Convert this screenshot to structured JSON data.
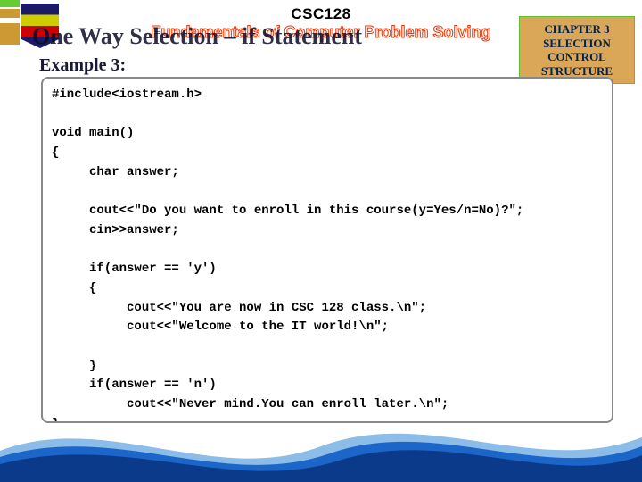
{
  "course_code": "CSC128",
  "course_subtitle": "Fundamentals of Computer Problem Solving",
  "title_overlay": "One Way Selection – if Statement",
  "example_label": "Example 3:",
  "chapter_box": {
    "line1": "CHAPTER 3",
    "line2": "SELECTION CONTROL",
    "line3": "STRUCTURE"
  },
  "code": "#include<iostream.h>\n\nvoid main()\n{\n     char answer;\n\n     cout<<\"Do you want to enroll in this course(y=Yes/n=No)?\";\n     cin>>answer;\n\n     if(answer == 'y')\n     {\n          cout<<\"You are now in CSC 128 class.\\n\";\n          cout<<\"Welcome to the IT world!\\n\";\n\n     }\n     if(answer == 'n')\n          cout<<\"Never mind.You can enroll later.\\n\";\n}",
  "colors": {
    "accent_orange": "#d9a757",
    "stroke_red": "#e30",
    "wave_blue1": "#0b3a8a",
    "wave_blue2": "#1d66c9",
    "wave_blue3": "#8cbce8"
  }
}
